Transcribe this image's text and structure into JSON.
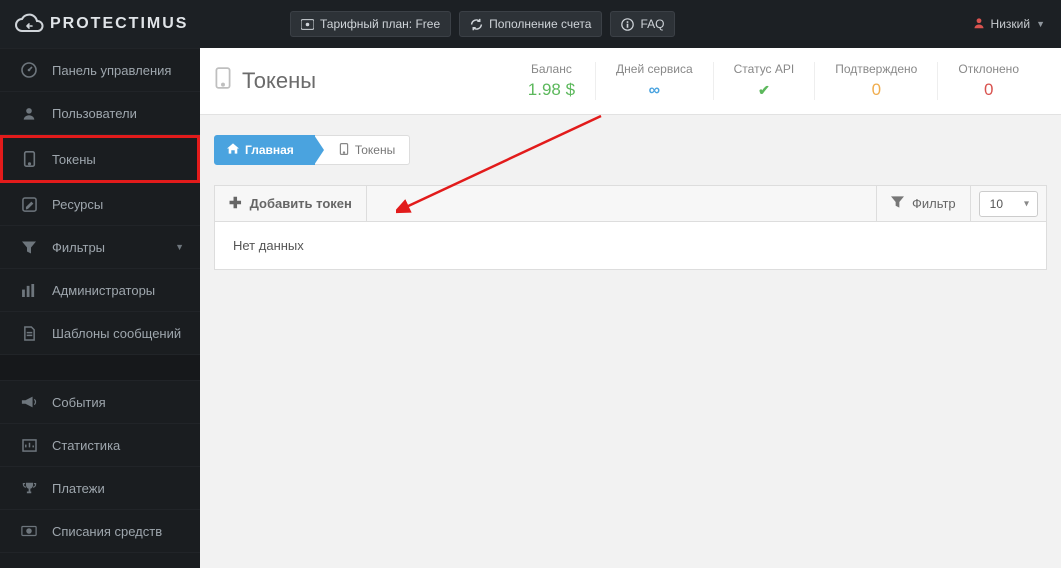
{
  "brand": "PROTECTIMUS",
  "top": {
    "plan": "Тарифный план: Free",
    "topup": "Пополнение счета",
    "faq": "FAQ",
    "user": "Низкий"
  },
  "sidebar": [
    {
      "key": "dashboard",
      "label": "Панель управления",
      "icon": "dashboard"
    },
    {
      "key": "users",
      "label": "Пользователи",
      "icon": "user"
    },
    {
      "key": "tokens",
      "label": "Токены",
      "icon": "tablet",
      "active": true
    },
    {
      "key": "resources",
      "label": "Ресурсы",
      "icon": "pencil"
    },
    {
      "key": "filters",
      "label": "Фильтры",
      "icon": "filter",
      "caret": true
    },
    {
      "key": "admins",
      "label": "Администраторы",
      "icon": "bars"
    },
    {
      "key": "templates",
      "label": "Шаблоны сообщений",
      "icon": "file"
    },
    {
      "gap": true
    },
    {
      "key": "events",
      "label": "События",
      "icon": "megaphone"
    },
    {
      "key": "stats",
      "label": "Статистика",
      "icon": "chart"
    },
    {
      "key": "payments",
      "label": "Платежи",
      "icon": "trophy"
    },
    {
      "key": "charges",
      "label": "Списания средств",
      "icon": "money"
    }
  ],
  "page": {
    "title": "Токены",
    "stats": [
      {
        "key": "balance",
        "label": "Баланс",
        "value": "1.98 $",
        "cls": "green"
      },
      {
        "key": "days",
        "label": "Дней сервиса",
        "value": "∞",
        "cls": "blue",
        "infinity": true
      },
      {
        "key": "api",
        "label": "Статус API",
        "value": "✓",
        "cls": "green",
        "check": true
      },
      {
        "key": "confirmed",
        "label": "Подтверждено",
        "value": "0",
        "cls": "orange"
      },
      {
        "key": "rejected",
        "label": "Отклонено",
        "value": "0",
        "cls": "red"
      }
    ],
    "crumbs": {
      "home": "Главная",
      "current": "Токены"
    },
    "toolbar": {
      "add": "Добавить токен",
      "filter": "Фильтр",
      "pagesize": "10"
    },
    "empty": "Нет данных"
  }
}
